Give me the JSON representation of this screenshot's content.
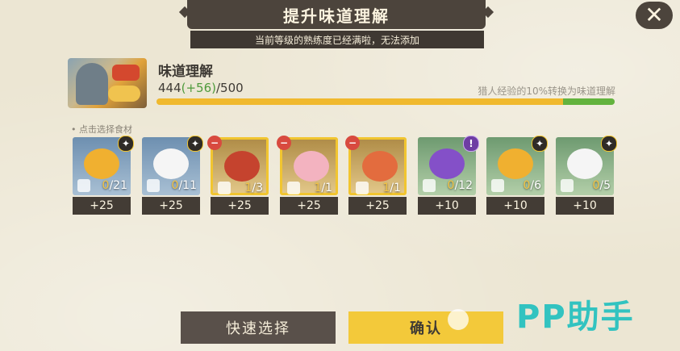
{
  "header": {
    "title": "提升味道理解",
    "notice": "当前等级的熟练度已经满啦，无法添加",
    "close_icon": "close-icon"
  },
  "skill": {
    "name": "味道理解",
    "current": "444",
    "gain": "(+56)",
    "max": "/500",
    "hint": "猎人经验的10%转换为味道理解",
    "progress_fraction": 0.888,
    "gain_fraction": 0.112,
    "colors": {
      "progress": "#f0b92e",
      "gain": "#63b33e"
    }
  },
  "section_label": "• 点击选择食材",
  "ingredients": [
    {
      "name": "golden-chips",
      "style": "blue",
      "badge": "fork",
      "count_cur": "0",
      "count_max": "/21",
      "bonus": "+25",
      "food_color": "#f0b030"
    },
    {
      "name": "cream",
      "style": "blue",
      "badge": "fork",
      "count_cur": "0",
      "count_max": "/11",
      "bonus": "+25",
      "food_color": "#f5f5f5"
    },
    {
      "name": "bacon",
      "style": "gold",
      "badge": "minus",
      "count_cur": "1",
      "count_max": "/3",
      "bonus": "+25",
      "food_color": "#c5432e"
    },
    {
      "name": "meat",
      "style": "gold",
      "badge": "minus",
      "count_cur": "1",
      "count_max": "/1",
      "bonus": "+25",
      "food_color": "#f3b3c0"
    },
    {
      "name": "shrimp",
      "style": "gold",
      "badge": "minus",
      "count_cur": "1",
      "count_max": "/1",
      "bonus": "+25",
      "food_color": "#e36c3e"
    },
    {
      "name": "grapes",
      "style": "green",
      "badge": "excl",
      "count_cur": "0",
      "count_max": "/12",
      "bonus": "+10",
      "food_color": "#8450c8"
    },
    {
      "name": "golden-chips",
      "style": "green",
      "badge": "fork",
      "count_cur": "0",
      "count_max": "/6",
      "bonus": "+10",
      "food_color": "#f0b030"
    },
    {
      "name": "cream",
      "style": "green",
      "badge": "fork",
      "count_cur": "0",
      "count_max": "/5",
      "bonus": "+10",
      "food_color": "#f5f5f5"
    }
  ],
  "buttons": {
    "quick_select": "快速选择",
    "confirm": "确认"
  },
  "watermark": "PP助手"
}
